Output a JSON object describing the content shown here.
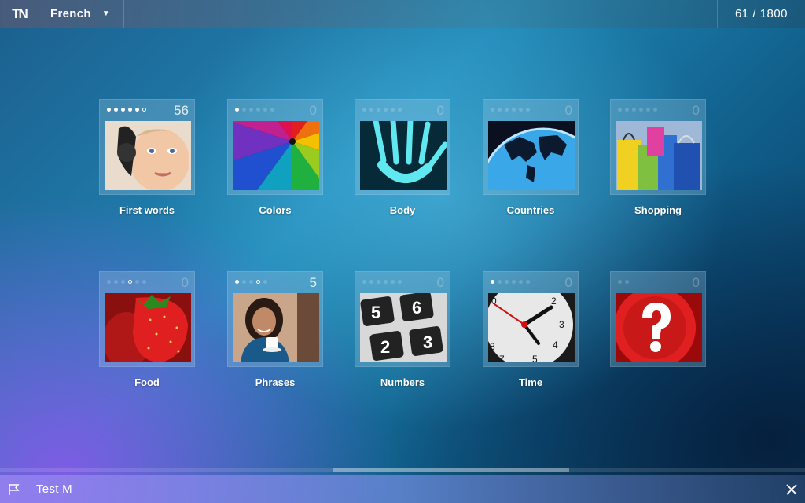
{
  "header": {
    "logo": "TN",
    "language": "French",
    "score": "61 / 1800"
  },
  "categories": [
    {
      "label": "First words",
      "count": "56",
      "dots": [
        "on",
        "on",
        "on",
        "on",
        "on",
        "ring"
      ],
      "icon": "baby-photo"
    },
    {
      "label": "Colors",
      "count": "0",
      "dots": [
        "on",
        "off",
        "off",
        "off",
        "off",
        "off"
      ],
      "icon": "umbrella-photo"
    },
    {
      "label": "Body",
      "count": "0",
      "dots": [
        "off",
        "off",
        "off",
        "off",
        "off",
        "off"
      ],
      "icon": "xray-hand-photo"
    },
    {
      "label": "Countries",
      "count": "0",
      "dots": [
        "off",
        "off",
        "off",
        "off",
        "off",
        "off"
      ],
      "icon": "globe-photo"
    },
    {
      "label": "Shopping",
      "count": "0",
      "dots": [
        "off",
        "off",
        "off",
        "off",
        "off",
        "off"
      ],
      "icon": "shopping-bags-photo"
    },
    {
      "label": "Food",
      "count": "0",
      "dots": [
        "off",
        "off",
        "off",
        "ring",
        "off",
        "off"
      ],
      "icon": "strawberry-photo"
    },
    {
      "label": "Phrases",
      "count": "5",
      "dots": [
        "on",
        "off",
        "off",
        "ring",
        "off"
      ],
      "icon": "woman-cup-photo"
    },
    {
      "label": "Numbers",
      "count": "0",
      "dots": [
        "off",
        "off",
        "off",
        "off",
        "off",
        "off"
      ],
      "icon": "keypad-photo"
    },
    {
      "label": "Time",
      "count": "0",
      "dots": [
        "on",
        "off",
        "off",
        "off",
        "off",
        "off"
      ],
      "icon": "clock-photo"
    },
    {
      "label": "",
      "count": "0",
      "dots": [
        "off",
        "off"
      ],
      "icon": "question-mark-icon"
    }
  ],
  "footer": {
    "test_label": "Test M"
  }
}
